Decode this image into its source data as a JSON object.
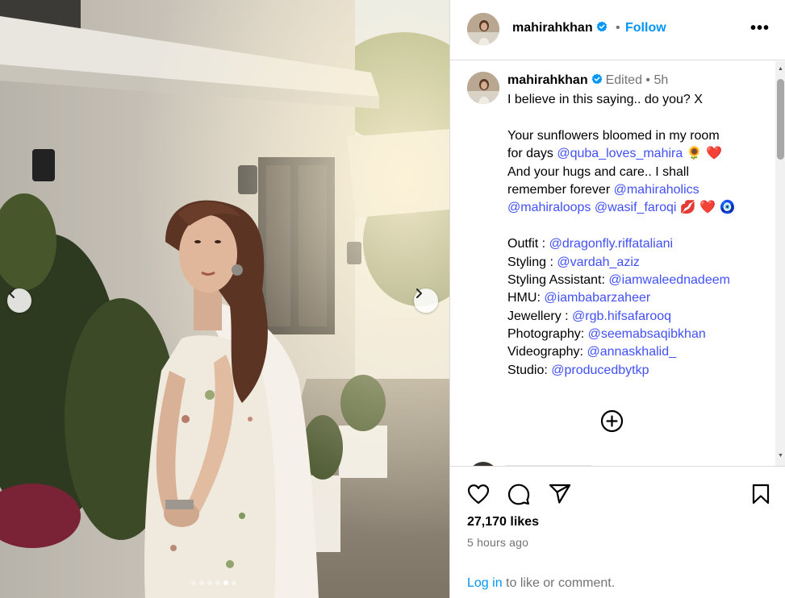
{
  "post": {
    "username": "mahirahkhan",
    "follow_label": "Follow",
    "separator": "•",
    "more_label": "•••"
  },
  "caption": {
    "username": "mahirahkhan",
    "meta": "Edited • 5h",
    "lines": [
      [
        {
          "t": "I believe in this saying.. do you? X"
        }
      ],
      [],
      [
        {
          "t": "Your sunflowers bloomed in my room"
        }
      ],
      [
        {
          "t": "for days "
        },
        {
          "t": "@quba_loves_mahira",
          "link": true
        },
        {
          "t": " 🌻 ❤️"
        }
      ],
      [
        {
          "t": "And your hugs and care.. I shall"
        }
      ],
      [
        {
          "t": "remember forever "
        },
        {
          "t": "@mahiraholics",
          "link": true
        }
      ],
      [
        {
          "t": "@mahiraloops",
          "link": true
        },
        {
          "t": " "
        },
        {
          "t": "@wasif_faroqi",
          "link": true
        },
        {
          "t": " 💋 ❤️ 🧿"
        }
      ],
      [],
      [
        {
          "t": "Outfit : "
        },
        {
          "t": "@dragonfly.riffataliani",
          "link": true
        }
      ],
      [
        {
          "t": "Styling : "
        },
        {
          "t": "@vardah_aziz",
          "link": true
        }
      ],
      [
        {
          "t": "Styling Assistant: "
        },
        {
          "t": "@iamwaleednadeem",
          "link": true
        }
      ],
      [
        {
          "t": "HMU: "
        },
        {
          "t": "@iambabarzaheer",
          "link": true
        }
      ],
      [
        {
          "t": "Jewellery : "
        },
        {
          "t": "@rgb.hifsafarooq",
          "link": true
        }
      ],
      [
        {
          "t": "Photography: "
        },
        {
          "t": "@seemabsaqibkhan",
          "link": true
        }
      ],
      [
        {
          "t": "Videography: "
        },
        {
          "t": "@annaskhalid_",
          "link": true
        }
      ],
      [
        {
          "t": "Studio: "
        },
        {
          "t": "@producedbytkp",
          "link": true
        }
      ]
    ]
  },
  "stats": {
    "likes": "27,170 likes",
    "time_ago": "5 hours ago"
  },
  "login": {
    "link": "Log in",
    "rest": " to like or comment."
  },
  "carousel": {
    "slides": 6,
    "active_index": 4
  },
  "colors": {
    "link": "#4150f7",
    "follow": "#0095f6",
    "verified": "#0095f6",
    "muted": "#737373"
  },
  "icons": [
    "verified-badge-icon",
    "more-options-icon",
    "add-circle-icon",
    "heart-icon",
    "comment-icon",
    "share-icon",
    "bookmark-icon",
    "chevron-left-icon",
    "chevron-right-icon"
  ]
}
